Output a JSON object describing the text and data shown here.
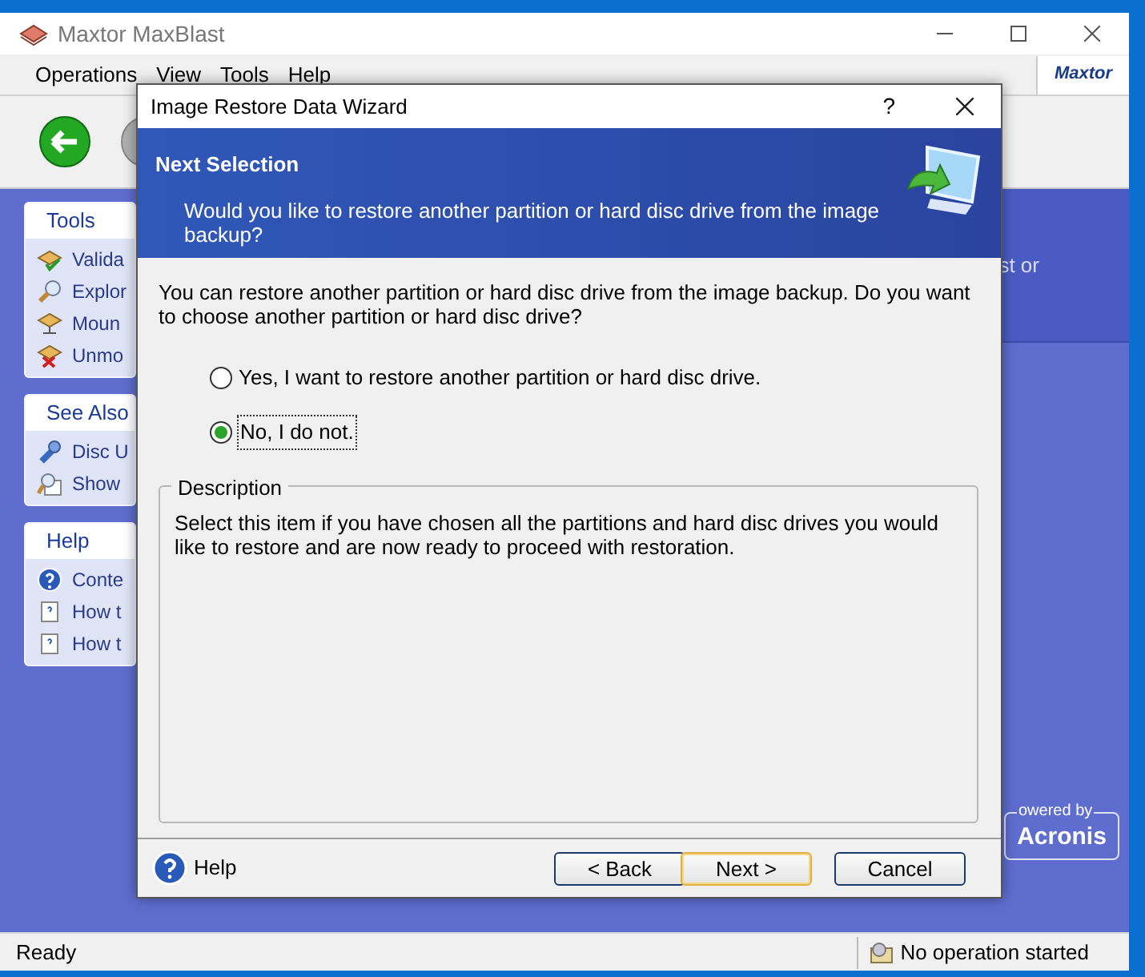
{
  "window": {
    "title": "Maxtor MaxBlast",
    "logo": "Maxtor"
  },
  "menu": [
    {
      "label": "Operations"
    },
    {
      "label": "View"
    },
    {
      "label": "Tools"
    },
    {
      "label": "Help"
    }
  ],
  "sidebar": {
    "panels": [
      {
        "title": "Tools",
        "items": [
          "Valida",
          "Explor",
          "Moun",
          "Unmo"
        ]
      },
      {
        "title": "See Also",
        "items": [
          "Disc U",
          "Show"
        ]
      },
      {
        "title": "Help",
        "items": [
          "Conte",
          "How t",
          "How t"
        ]
      }
    ]
  },
  "main_text": "st or",
  "powered_by": {
    "caption": "owered by",
    "brand": "Acronis"
  },
  "dialog": {
    "title": "Image Restore Data Wizard",
    "help_glyph": "?",
    "header": {
      "title": "Next Selection",
      "subtitle": "Would you like to restore another partition or hard disc drive from the image backup?"
    },
    "prompt": "You can restore another partition or hard disc drive from the image backup. Do you want to choose another partition or hard disc drive?",
    "options": [
      {
        "label": "Yes, I want to restore another partition or hard disc drive.",
        "selected": false
      },
      {
        "label": "No, I do not.",
        "selected": true
      }
    ],
    "description": {
      "title": "Description",
      "text": "Select this item if you have chosen all the partitions and hard disc drives you would like to restore and are now ready to proceed with restoration."
    },
    "help_link": "Help",
    "buttons": [
      {
        "label": "< Back",
        "default": false
      },
      {
        "label": "Next >",
        "default": true
      },
      {
        "label": "Cancel",
        "default": false
      }
    ]
  },
  "status_bar": {
    "left": "Ready",
    "right": "No operation started"
  }
}
